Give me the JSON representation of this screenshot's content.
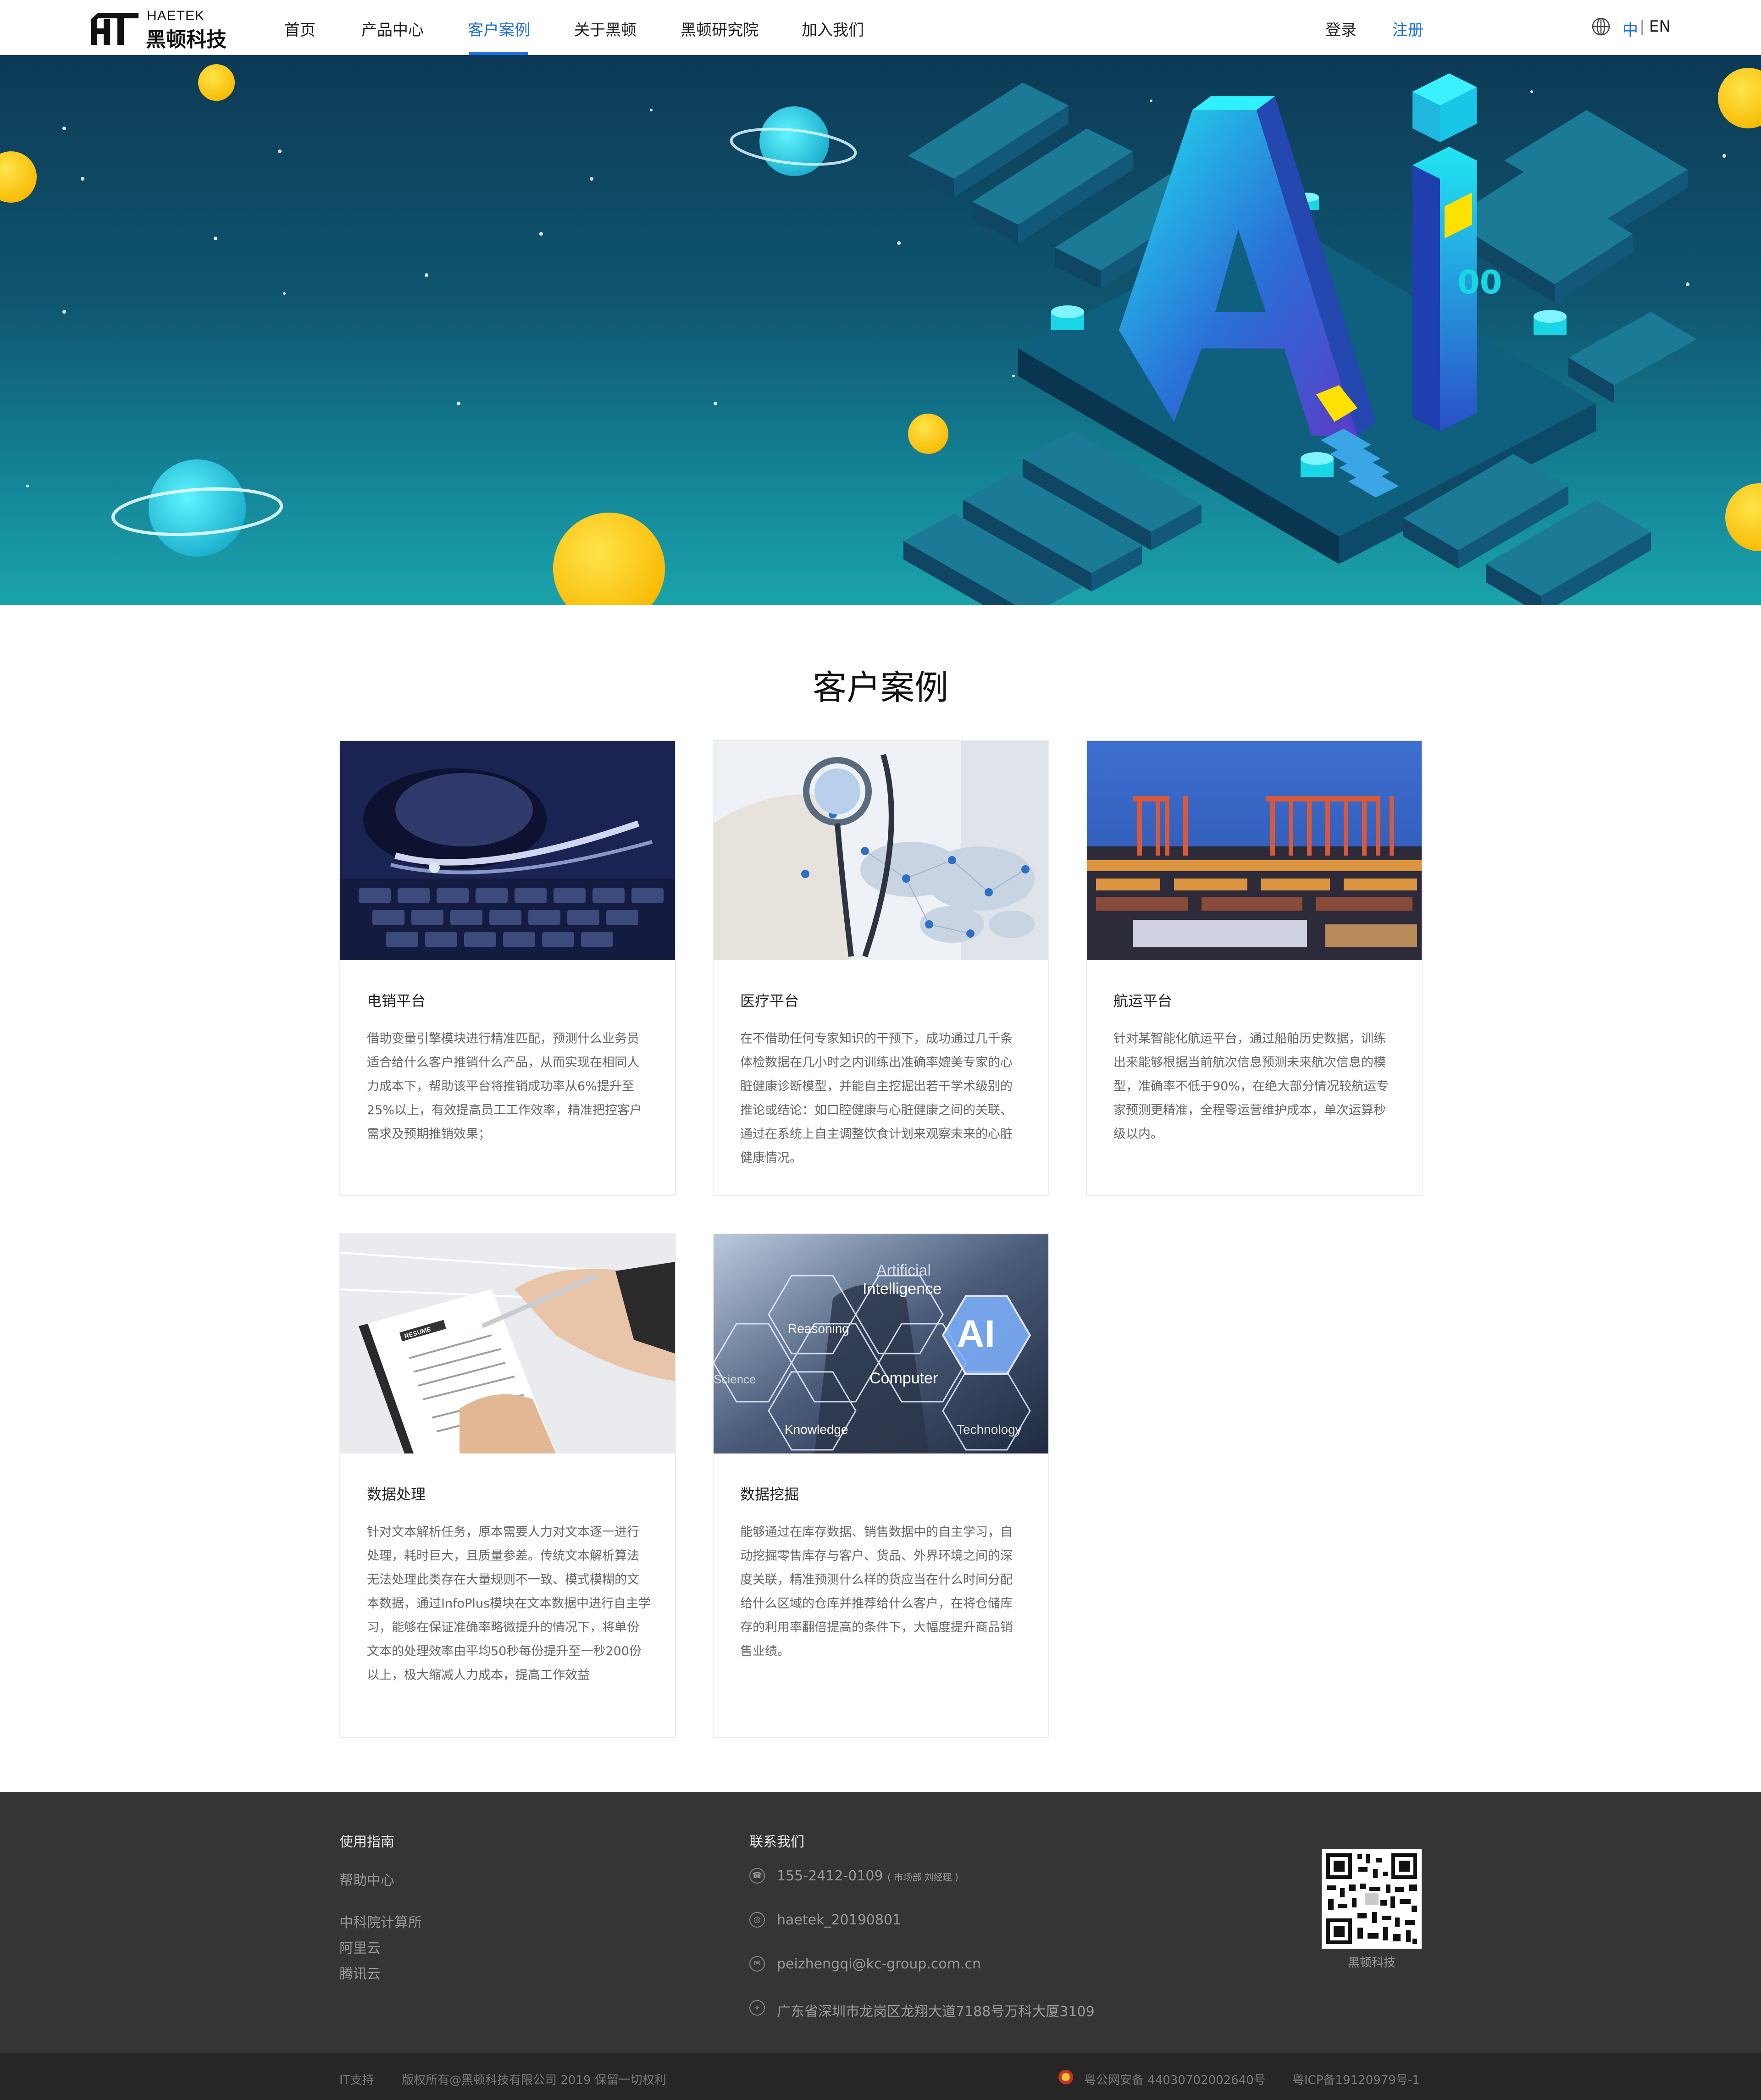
{
  "brand": {
    "name_en": "HAETEK",
    "name_cn": "黑顿科技"
  },
  "nav": {
    "items": [
      {
        "label": "首页"
      },
      {
        "label": "产品中心"
      },
      {
        "label": "客户案例"
      },
      {
        "label": "关于黑顿"
      },
      {
        "label": "黑顿研究院"
      },
      {
        "label": "加入我们"
      }
    ],
    "active_index": 2,
    "login": "登录",
    "register": "注册",
    "lang_zh": "中",
    "lang_sep": "|",
    "lang_en": "EN"
  },
  "banner": {
    "art_text": "AI",
    "art_suffix": "00",
    "colors": {
      "sky_top": "#0d3a56",
      "sky_bottom": "#1aa3ab",
      "planet": "#ffcc00",
      "cyan": "#19d6e6"
    }
  },
  "section": {
    "title": "客户案例"
  },
  "cases": [
    {
      "title": "电销平台",
      "desc": "借助变量引擎模块进行精准匹配，预测什么业务员适合给什么客户推销什么产品，从而实现在相同人力成本下，帮助该平台将推销成功率从6%提升至25%以上，有效提高员工工作效率，精准把控客户需求及预期推销效果；"
    },
    {
      "title": "医疗平台",
      "desc": "在不借助任何专家知识的干预下，成功通过几千条体检数据在几小时之内训练出准确率媲美专家的心脏健康诊断模型，并能自主挖掘出若干学术级别的推论或结论：如口腔健康与心脏健康之间的关联、通过在系统上自主调整饮食计划来观察未来的心脏健康情况。"
    },
    {
      "title": "航运平台",
      "desc": "针对某智能化航运平台，通过船舶历史数据，训练出来能够根据当前航次信息预测未来航次信息的模型，准确率不低于90%，在绝大部分情况较航运专家预测更精准，全程零运营维护成本，单次运算秒级以内。"
    },
    {
      "title": "数据处理",
      "desc": "针对文本解析任务，原本需要人力对文本逐一进行处理，耗时巨大，且质量参差。传统文本解析算法无法处理此类存在大量规则不一致、模式模糊的文本数据，通过InfoPlus模块在文本数据中进行自主学习，能够在保证准确率略微提升的情况下，将单份文本的处理效率由平均50秒每份提升至一秒200份以上，极大缩减人力成本，提高工作效益"
    },
    {
      "title": "数据挖掘",
      "desc": "能够通过在库存数据、销售数据中的自主学习，自动挖掘零售库存与客户、货品、外界环境之间的深度关联，精准预测什么样的货应当在什么时间分配给什么区域的仓库并推荐给什么客户，在将仓储库存的利用率翻倍提高的条件下，大幅度提升商品销售业绩。"
    }
  ],
  "case_images": {
    "resume_tag": "RESUME",
    "ai_words": [
      "Artificial",
      "Intelligence",
      "AI",
      "Reasoning",
      "Computer",
      "Science",
      "Knowledge",
      "Technology"
    ]
  },
  "footer": {
    "guide_title": "使用指南",
    "guide_links": [
      "帮助中心",
      "中科院计算所",
      "阿里云",
      "腾讯云"
    ],
    "contact_title": "联系我们",
    "phone": "155-2412-0109",
    "phone_note": "( 市场部  刘经理 )",
    "wechat": "haetek_20190801",
    "email": "peizhengqi@kc-group.com.cn",
    "address": "广东省深圳市龙岗区龙翔大道7188号万科大厦3109",
    "qr_label": "黑顿科技"
  },
  "bottom": {
    "support": "IT支持",
    "copyright": "版权所有@黑顿科技有限公司 2019 保留一切权利",
    "police": "粤公网安备 44030702002640号",
    "icp": "粤ICP备19120979号-1"
  }
}
